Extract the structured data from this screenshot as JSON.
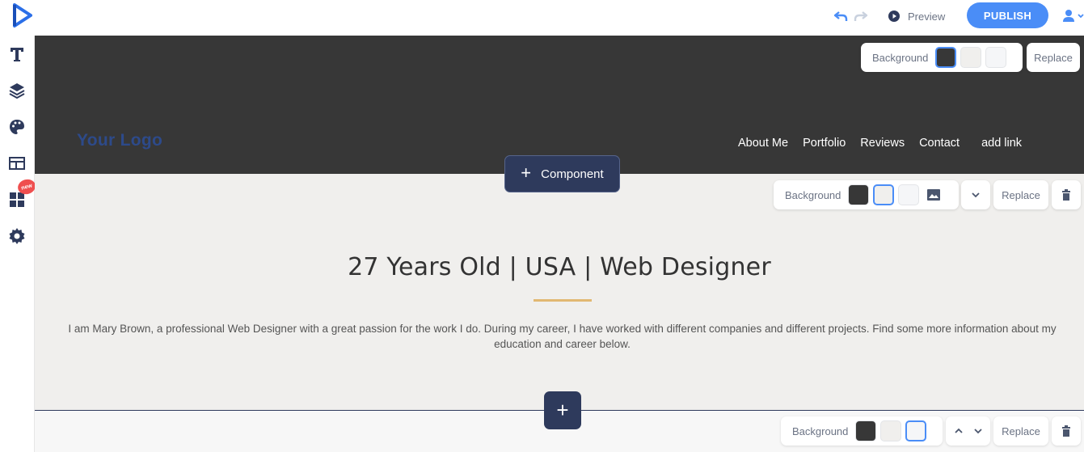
{
  "topbar": {
    "preview_label": "Preview",
    "publish_label": "PUBLISH"
  },
  "header": {
    "logo_text": "Your Logo",
    "nav": [
      "About Me",
      "Portfolio",
      "Reviews",
      "Contact",
      "add link"
    ],
    "controls": {
      "background_label": "Background",
      "replace_label": "Replace"
    }
  },
  "component_button": {
    "label": "Component"
  },
  "main": {
    "headline": "27 Years Old | USA | Web Designer",
    "description": "I am Mary Brown, a professional Web Designer with a great passion for the work I do. During my career, I have worked with different companies and different projects. Find some more information about my education and career below.",
    "controls": {
      "background_label": "Background",
      "replace_label": "Replace"
    }
  },
  "bottom": {
    "controls": {
      "background_label": "Background",
      "replace_label": "Replace"
    }
  },
  "sidebar": {
    "badge": "new"
  },
  "colors": {
    "accent": "#4a8df7",
    "dark_section": "#373737",
    "navy": "#2e3a5c",
    "gold_bar": "#e2b872"
  },
  "icons": [
    "brand-logo-icon",
    "undo-icon",
    "redo-icon",
    "play-icon",
    "user-icon",
    "text-icon",
    "layers-icon",
    "palette-icon",
    "layout-icon",
    "widgets-icon",
    "gear-icon",
    "image-icon",
    "chevron-down-icon",
    "chevron-up-icon",
    "trash-icon",
    "plus-icon"
  ]
}
